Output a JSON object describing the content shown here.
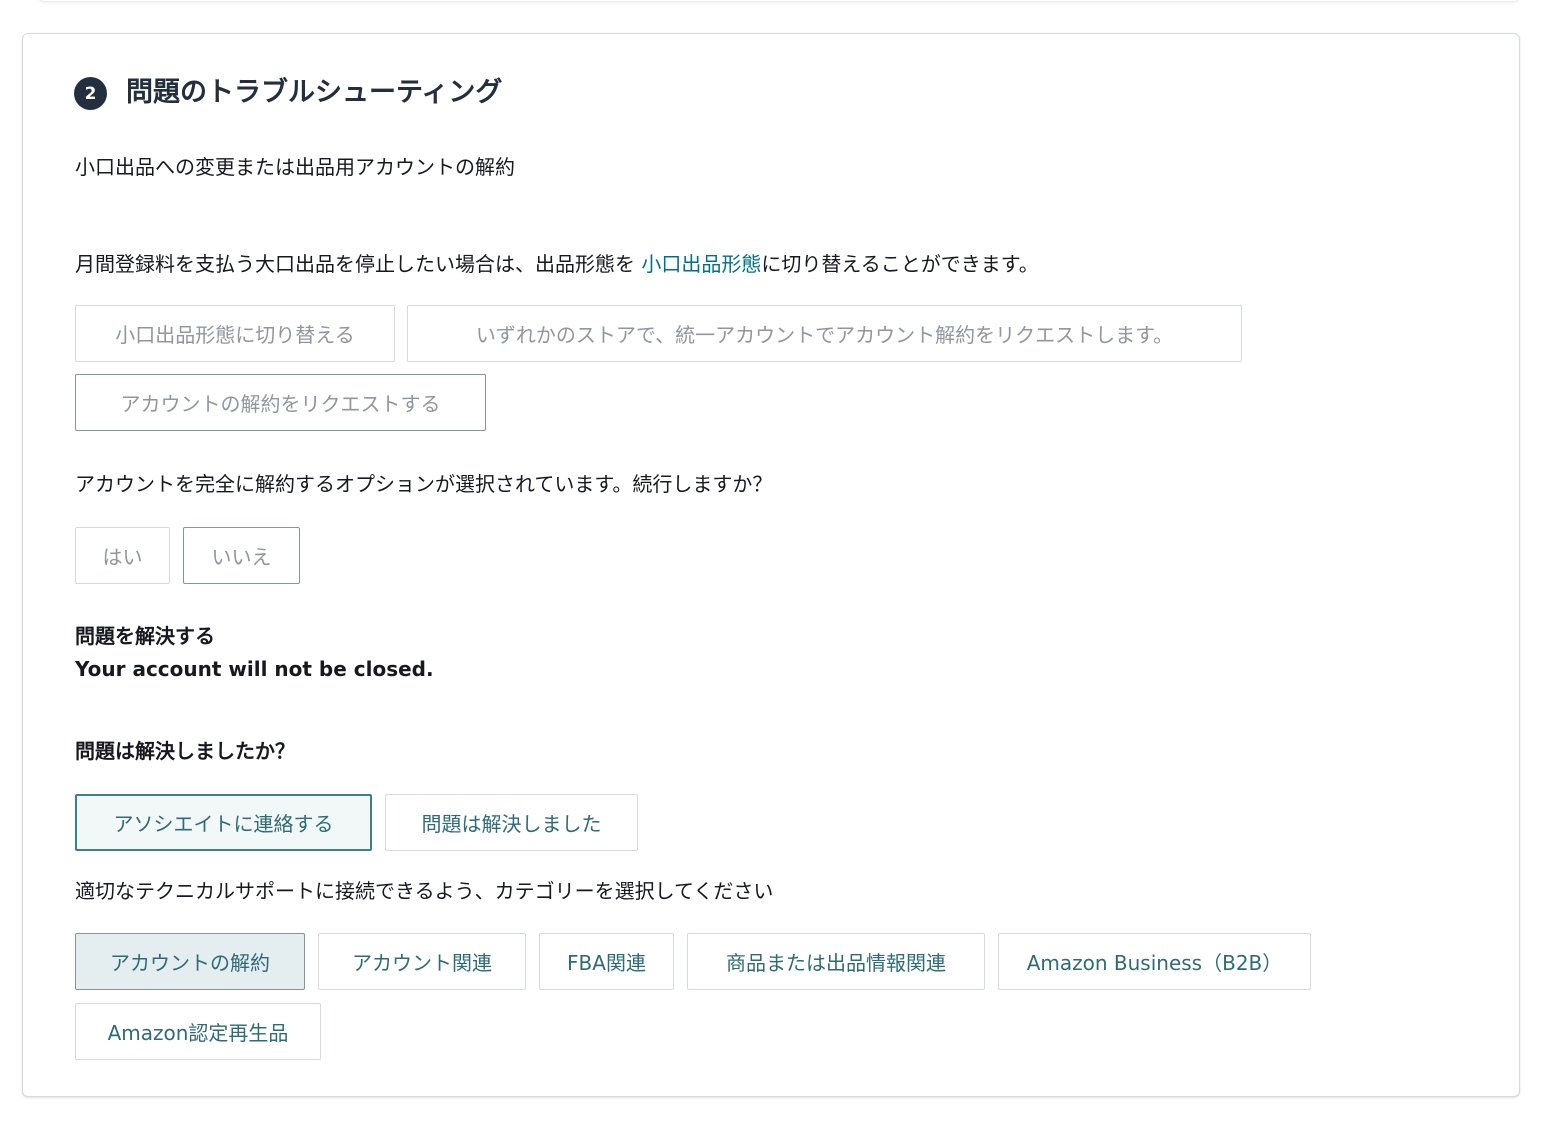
{
  "section": {
    "step_number": "2",
    "title": "問題のトラブルシューティング",
    "subtitle": "小口出品への変更または出品用アカウントの解約"
  },
  "intro": {
    "text_before": "月間登録料を支払う大口出品を停止したい場合は、出品形態を ",
    "link_text": "小口出品形態",
    "text_after": "に切り替えることができます。"
  },
  "options": {
    "switch_button": "小口出品形態に切り替える",
    "unified_close_button": "いずれかのストアで、統一アカウントでアカウント解約をリクエストします。",
    "request_close_button": "アカウントの解約をリクエストする"
  },
  "confirm": {
    "question": "アカウントを完全に解約するオプションが選択されています。続行しますか？",
    "yes": "はい",
    "no": "いいえ"
  },
  "resolution": {
    "heading": "問題を解決する",
    "message": "Your account will not be closed."
  },
  "resolved_prompt": {
    "question": "問題は解決しましたか？",
    "contact_button": "アソシエイトに連絡する",
    "resolved_button": "問題は解決しました"
  },
  "category": {
    "prompt": "適切なテクニカルサポートに接続できるよう、カテゴリーを選択してください",
    "items": [
      "アカウントの解約",
      "アカウント関連",
      "FBA関連",
      "商品または出品情報関連",
      "Amazon Business（B2B）",
      "Amazon認定再生品"
    ]
  }
}
